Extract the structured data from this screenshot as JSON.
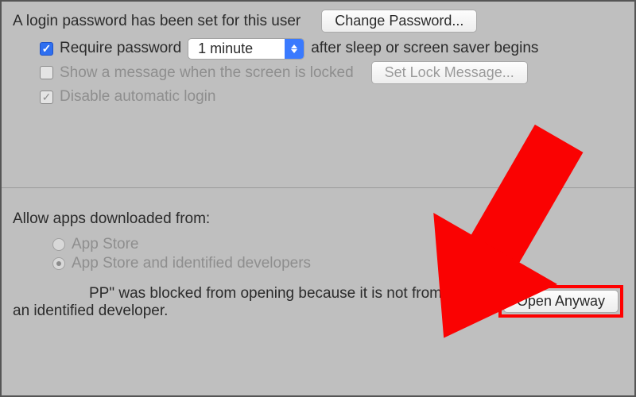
{
  "password": {
    "info": "A login password has been set for this user",
    "change_btn": "Change Password...",
    "require_label": "Require password",
    "delay_selected": "1 minute",
    "after_sleep": "after sleep or screen saver begins",
    "show_message_label": "Show a message when the screen is locked",
    "set_lock_msg_btn": "Set Lock Message...",
    "disable_auto_login": "Disable automatic login"
  },
  "downloads": {
    "heading": "Allow apps downloaded from:",
    "opt_app_store": "App Store",
    "opt_identified": "App Store and identified developers"
  },
  "blocked": {
    "line1": "PP\" was blocked from opening because it is not from",
    "line2": "an identified developer.",
    "open_anyway": "Open Anyway"
  },
  "annotation": {
    "arrow_color": "#fa0202"
  }
}
